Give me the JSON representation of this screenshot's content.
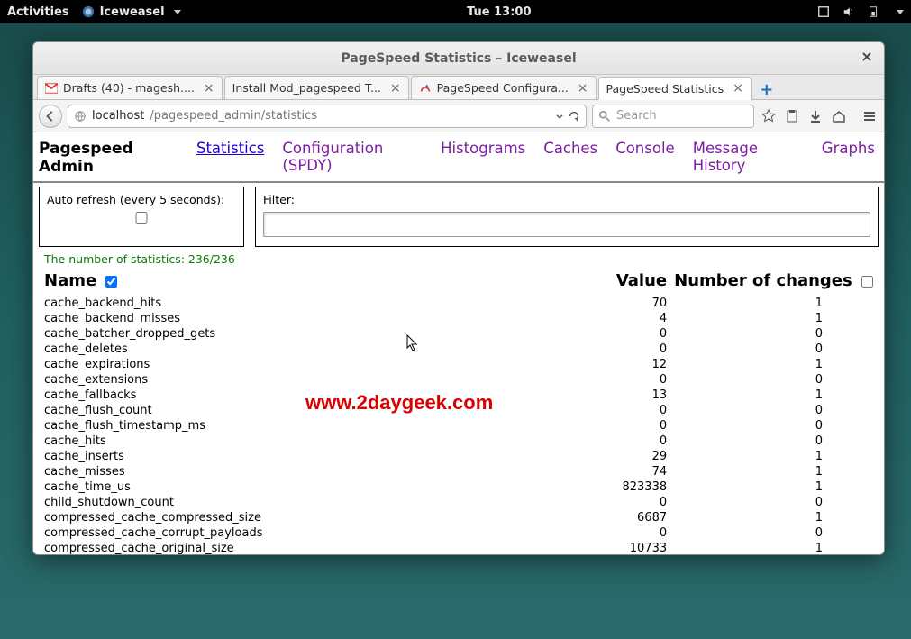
{
  "gnome": {
    "activities": "Activities",
    "app_name": "Iceweasel",
    "clock": "Tue 13:00"
  },
  "window": {
    "title": "PageSpeed Statistics – Iceweasel"
  },
  "tabs": [
    {
      "label": "Drafts (40) - magesh...."
    },
    {
      "label": "Install Mod_pagespeed T..."
    },
    {
      "label": "PageSpeed Configura..."
    },
    {
      "label": "PageSpeed Statistics"
    }
  ],
  "url": {
    "host": "localhost",
    "path": "/pagespeed_admin/statistics"
  },
  "search_placeholder": "Search",
  "page": {
    "admin_title": "Pagespeed Admin",
    "nav": {
      "statistics": "Statistics",
      "configuration": "Configuration (SPDY)",
      "histograms": "Histograms",
      "caches": "Caches",
      "console": "Console",
      "message_history": "Message History",
      "graphs": "Graphs"
    },
    "auto_refresh_label": "Auto refresh (every 5 seconds):",
    "filter_label": "Filter:",
    "stat_count": "The number of statistics: 236/236",
    "columns": {
      "name": "Name",
      "value": "Value",
      "changes": "Number of changes"
    },
    "rows": [
      {
        "name": "cache_backend_hits",
        "value": 70,
        "changes": 1
      },
      {
        "name": "cache_backend_misses",
        "value": 4,
        "changes": 1
      },
      {
        "name": "cache_batcher_dropped_gets",
        "value": 0,
        "changes": 0
      },
      {
        "name": "cache_deletes",
        "value": 0,
        "changes": 0
      },
      {
        "name": "cache_expirations",
        "value": 12,
        "changes": 1
      },
      {
        "name": "cache_extensions",
        "value": 0,
        "changes": 0
      },
      {
        "name": "cache_fallbacks",
        "value": 13,
        "changes": 1
      },
      {
        "name": "cache_flush_count",
        "value": 0,
        "changes": 0
      },
      {
        "name": "cache_flush_timestamp_ms",
        "value": 0,
        "changes": 0
      },
      {
        "name": "cache_hits",
        "value": 0,
        "changes": 0
      },
      {
        "name": "cache_inserts",
        "value": 29,
        "changes": 1
      },
      {
        "name": "cache_misses",
        "value": 74,
        "changes": 1
      },
      {
        "name": "cache_time_us",
        "value": 823338,
        "changes": 1
      },
      {
        "name": "child_shutdown_count",
        "value": 0,
        "changes": 0
      },
      {
        "name": "compressed_cache_compressed_size",
        "value": 6687,
        "changes": 1
      },
      {
        "name": "compressed_cache_corrupt_payloads",
        "value": 0,
        "changes": 0
      },
      {
        "name": "compressed_cache_original_size",
        "value": 10733,
        "changes": 1
      }
    ]
  },
  "watermark": "www.2daygeek.com"
}
